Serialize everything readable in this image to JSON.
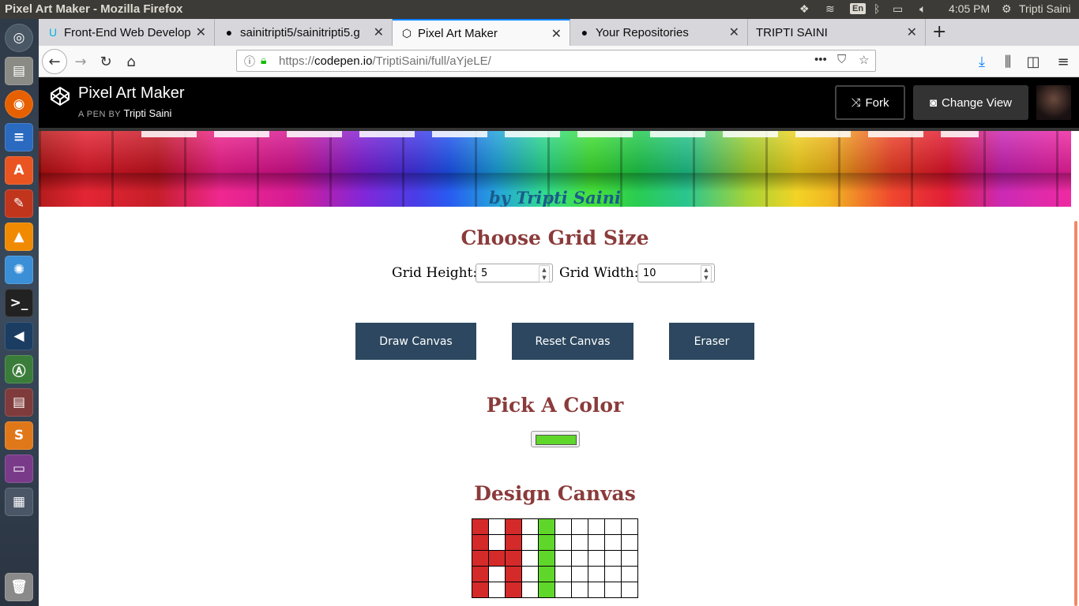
{
  "system": {
    "window_title": "Pixel Art Maker - Mozilla Firefox",
    "keyboard_layout": "En",
    "clock": "4:05 PM",
    "user": "Tripti Saini"
  },
  "browser": {
    "tabs": [
      {
        "label": "Front-End Web Develop",
        "icon": "udacity-icon"
      },
      {
        "label": "sainitripti5/sainitripti5.g",
        "icon": "github-icon"
      },
      {
        "label": "Pixel Art Maker",
        "icon": "codepen-icon"
      },
      {
        "label": "Your Repositories",
        "icon": "github-icon"
      },
      {
        "label": "TRIPTI SAINI",
        "icon": ""
      }
    ],
    "active_tab": 2,
    "url_prefix": "https://",
    "url_domain": "codepen.io",
    "url_path": "/TriptiSaini/full/aYjeLE/",
    "url_more": "•••"
  },
  "codepen": {
    "title": "Pixel Art Maker",
    "by_prefix": "A PEN BY",
    "author": "Tripti Saini",
    "fork_label": "Fork",
    "change_view_label": "Change View"
  },
  "banner": {
    "byline": "by Tripti Saini"
  },
  "app": {
    "grid_size_heading": "Choose Grid Size",
    "grid_height_label": "Grid Height:",
    "grid_height_value": "5",
    "grid_width_label": "Grid Width:",
    "grid_width_value": "10",
    "draw_button": "Draw Canvas",
    "reset_button": "Reset Canvas",
    "eraser_button": "Eraser",
    "color_heading": "Pick A Color",
    "selected_color": "#5fd62a",
    "canvas_heading": "Design Canvas",
    "canvas_colors": {
      "R": "#d42a2a",
      "G": "#5fd62a",
      "W": "#ffffff"
    },
    "canvas_rows": [
      "RWRWGWWWWW",
      "RWRWGWWWWW",
      "RRRWGWWWWW",
      "RWRWGWWWWW",
      "RWRWGWWWWW"
    ]
  }
}
